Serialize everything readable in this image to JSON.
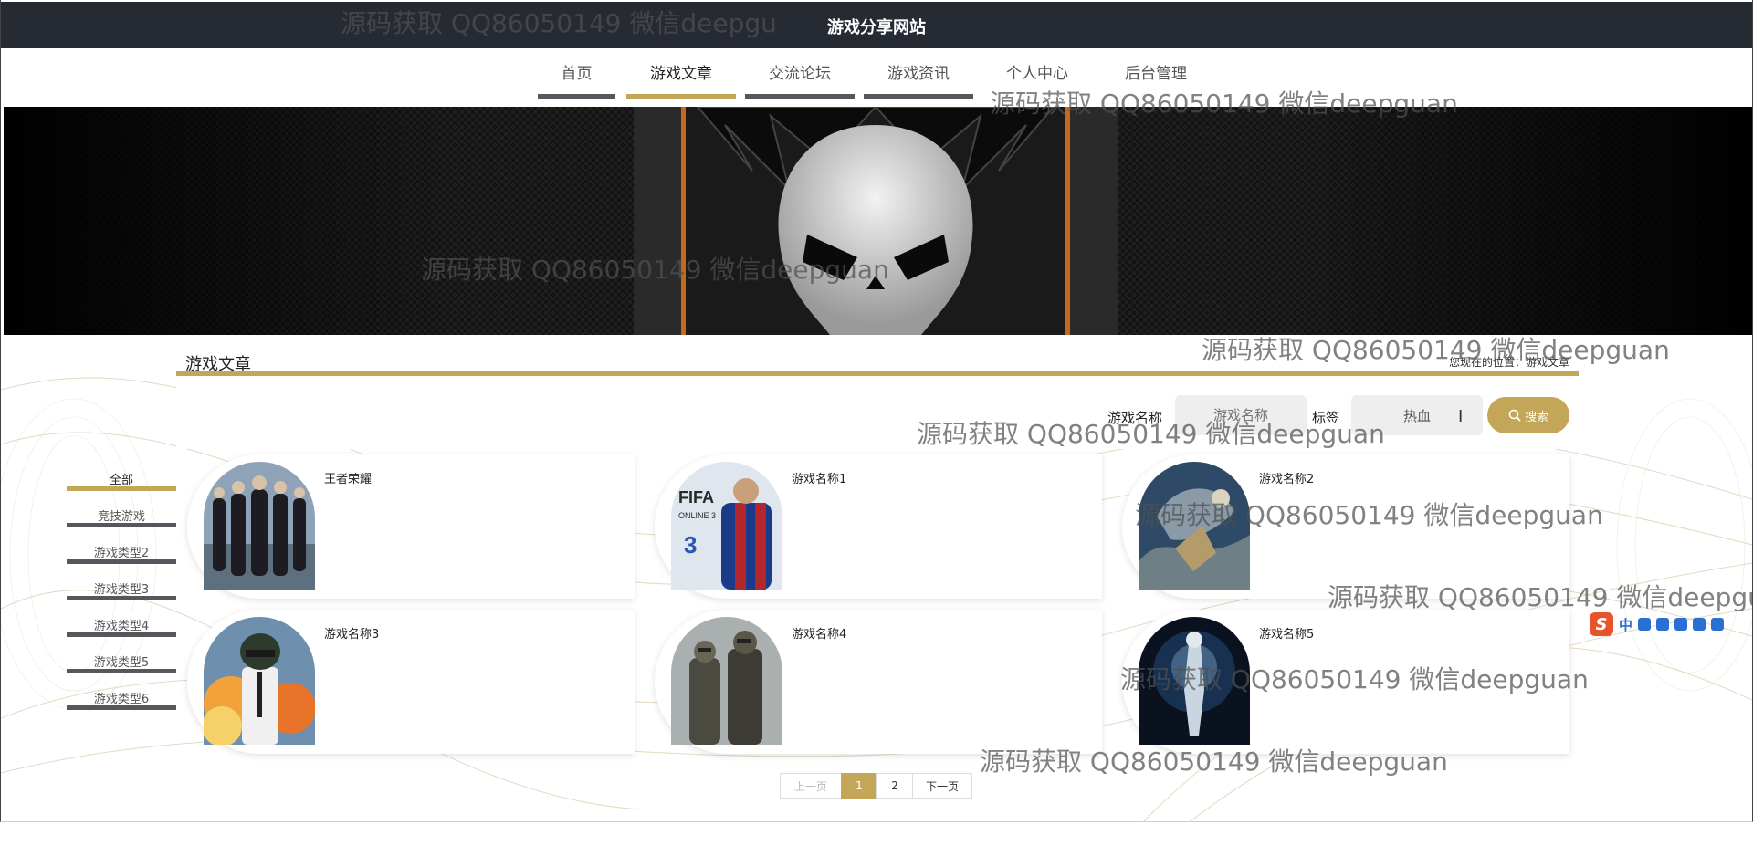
{
  "header": {
    "site_title": "游戏分享网站"
  },
  "nav": {
    "items": [
      {
        "label": "首页",
        "active": false
      },
      {
        "label": "游戏文章",
        "active": true
      },
      {
        "label": "交流论坛",
        "active": false
      },
      {
        "label": "游戏资讯",
        "active": false
      },
      {
        "label": "个人中心",
        "active": false
      },
      {
        "label": "后台管理",
        "active": false
      }
    ]
  },
  "section": {
    "title": "游戏文章",
    "breadcrumb": "您现在的位置：游戏文章"
  },
  "search": {
    "name_label": "游戏名称",
    "name_placeholder": "游戏名称",
    "tag_label": "标签",
    "tag_value": "热血",
    "button_label": "搜索"
  },
  "categories": [
    {
      "label": "全部",
      "active": true
    },
    {
      "label": "竞技游戏",
      "active": false
    },
    {
      "label": "游戏类型2",
      "active": false
    },
    {
      "label": "游戏类型3",
      "active": false
    },
    {
      "label": "游戏类型4",
      "active": false
    },
    {
      "label": "游戏类型5",
      "active": false
    },
    {
      "label": "游戏类型6",
      "active": false
    }
  ],
  "games": [
    {
      "name": "王者荣耀"
    },
    {
      "name": "游戏名称1"
    },
    {
      "name": "游戏名称2"
    },
    {
      "name": "游戏名称3"
    },
    {
      "name": "游戏名称4"
    },
    {
      "name": "游戏名称5"
    }
  ],
  "pagination": {
    "prev_label": "上一页",
    "pages": [
      "1",
      "2"
    ],
    "current_page": "1",
    "next_label": "下一页"
  },
  "watermarks": {
    "text": "源码获取 QQ86050149 微信deepguan",
    "text_cut": "源码获取 QQ86050149 微信deepgu"
  },
  "ime": {
    "logo": "S",
    "mode": "中"
  },
  "colors": {
    "accent": "#c4a659",
    "header_bg": "#262a33",
    "inactive_bar": "#55575c"
  }
}
